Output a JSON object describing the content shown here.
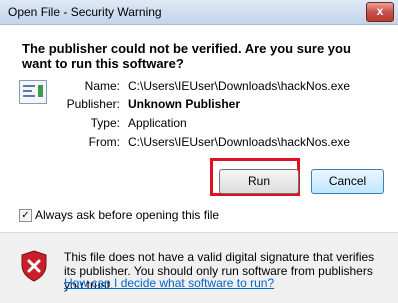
{
  "window": {
    "title": "Open File - Security Warning",
    "close_label": "x"
  },
  "dialog": {
    "heading": "The publisher could not be verified.  Are you sure you want to run this software?",
    "fields": [
      {
        "label": "Name:",
        "value": "C:\\Users\\IEUser\\Downloads\\hackNos.exe"
      },
      {
        "label": "Publisher:",
        "value": "Unknown Publisher"
      },
      {
        "label": "Type:",
        "value": "Application"
      },
      {
        "label": "From:",
        "value": "C:\\Users\\IEUser\\Downloads\\hackNos.exe"
      }
    ],
    "buttons": {
      "run": "Run",
      "cancel": "Cancel"
    },
    "checkbox": {
      "label": "Always ask before opening this file",
      "checked": true,
      "mark": "✓"
    },
    "warning": {
      "text": "This file does not have a valid digital signature that verifies its publisher.  You should only run software from publishers you trust.",
      "link": "How can I decide what software to run?"
    }
  },
  "colors": {
    "highlight": "#e01020",
    "link": "#0066cc",
    "shield": "#c8202a"
  }
}
